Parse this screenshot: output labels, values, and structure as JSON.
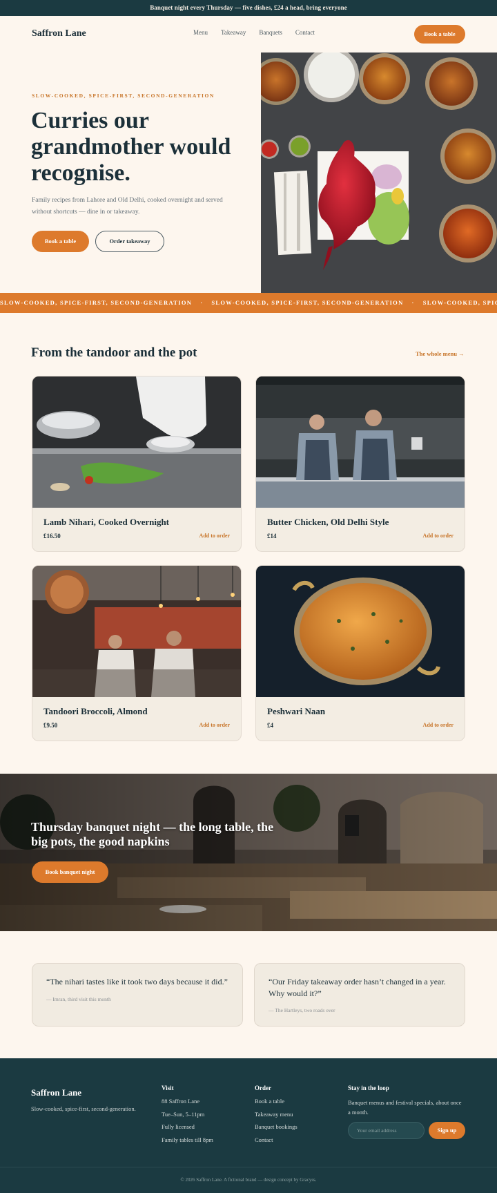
{
  "announcement": "Banquet night every Thursday — five dishes, £24 a head, bring everyone",
  "header": {
    "brand": "Saffron Lane",
    "nav": [
      "Menu",
      "Takeaway",
      "Banquets",
      "Contact"
    ],
    "cta": "Book a table"
  },
  "hero": {
    "kicker": "SLOW-COOKED, SPICE-FIRST, SECOND-GENERATION",
    "title": "Curries our grandmother would recognise.",
    "body": "Family recipes from Lahore and Old Delhi, cooked overnight and served without shortcuts — dine in or takeaway.",
    "primary": "Book a table",
    "secondary": "Order takeaway"
  },
  "strip": {
    "text": "SLOW-COOKED, SPICE-FIRST, SECOND-GENERATION",
    "separator": "·"
  },
  "menu": {
    "title": "From the tandoor and the pot",
    "link": "The whole menu →",
    "add_label": "Add to order",
    "items": [
      {
        "name": "Lamb Nihari, Cooked Overnight",
        "price": "£16.50"
      },
      {
        "name": "Butter Chicken, Old Delhi Style",
        "price": "£14"
      },
      {
        "name": "Tandoori Broccoli, Almond",
        "price": "£9.50"
      },
      {
        "name": "Peshwari Naan",
        "price": "£4"
      }
    ]
  },
  "banquet": {
    "title": "Thursday banquet night — the long table, the big pots, the good napkins",
    "cta": "Book banquet night"
  },
  "testimonials": [
    {
      "quote": "“The nihari tastes like it took two days because it did.”",
      "who": "— Imran, third visit this month"
    },
    {
      "quote": "“Our Friday takeaway order hasn’t changed in a year. Why would it?”",
      "who": "— The Hartleys, two roads over"
    }
  ],
  "footer": {
    "brand": "Saffron Lane",
    "tagline": "Slow-cooked, spice-first, second-generation.",
    "visit": {
      "title": "Visit",
      "lines": [
        "88 Saffron Lane",
        "Tue–Sun, 5–11pm",
        "Fully licensed",
        "Family tables till 8pm"
      ]
    },
    "order": {
      "title": "Order",
      "lines": [
        "Book a table",
        "Takeaway menu",
        "Banquet bookings",
        "Contact"
      ]
    },
    "newsletter": {
      "title": "Stay in the loop",
      "body": "Banquet menus and festival specials, about once a month.",
      "placeholder": "Your email address",
      "button": "Sign up"
    },
    "copyright": "© 2026 Saffron Lane. A fictional brand — design concept by Gracyss."
  },
  "colors": {
    "accent": "#dd7a2c",
    "dark": "#1b3a41",
    "cream": "#fdf6ee"
  }
}
